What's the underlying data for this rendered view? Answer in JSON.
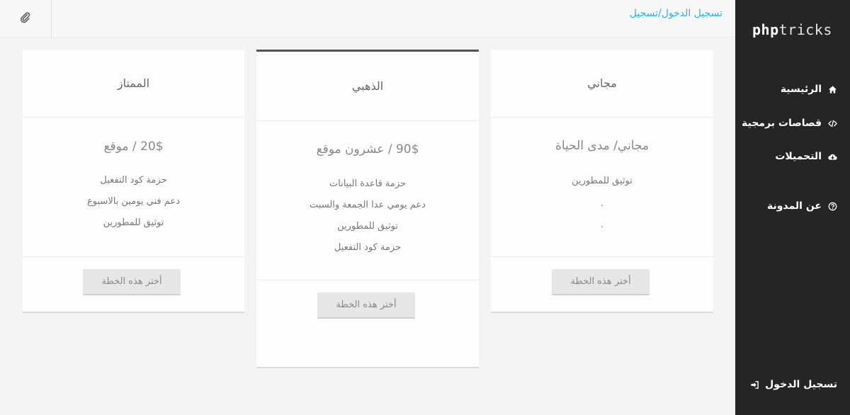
{
  "sidebar": {
    "logo_bold": "php",
    "logo_rest": "tricks",
    "items": [
      {
        "label": "الرئيسية",
        "icon": "home-icon"
      },
      {
        "label": "قصاصات برمجية",
        "icon": "code-icon"
      },
      {
        "label": "التحميلات",
        "icon": "cloud-download-icon"
      },
      {
        "label": "عن المدونة",
        "icon": "question-circle-icon"
      }
    ],
    "login": {
      "label": "تسجيل الدخول",
      "icon": "sign-in-icon"
    }
  },
  "header": {
    "breadcrumb_login": "تسجيل الدخول",
    "breadcrumb_sep": "/",
    "breadcrumb_register": "تسجيل",
    "attach_icon": "paperclip-icon"
  },
  "plans": {
    "free": {
      "title": "مجاني",
      "price": "مجاني/ مدى الحياة",
      "features": [
        "توثيق للمطورين",
        ".",
        "."
      ],
      "button": "أختر هذه الخطة"
    },
    "gold": {
      "title": "الذهبي",
      "price": "90$ / عشرون موقع",
      "features": [
        "حزمة قاعدة البيانات",
        "دعم يومي عدا الجمعة والسبت",
        "توثيق للمطورين",
        "حزمة كود التفعيل"
      ],
      "button": "أختر هذه الخطة"
    },
    "premium": {
      "title": "الممتاز",
      "price": "20$ / موقع",
      "features": [
        "حزمة كود التفعيل",
        "دعم فني يومين بالاسبوع",
        "توثيق للمطورين"
      ],
      "button": "أختر هذه الخطة"
    }
  },
  "colors": {
    "sidebar_bg": "#252525",
    "link": "#29b6d8",
    "page_bg": "#f3f3f3",
    "gold_top_border": "#555555"
  }
}
